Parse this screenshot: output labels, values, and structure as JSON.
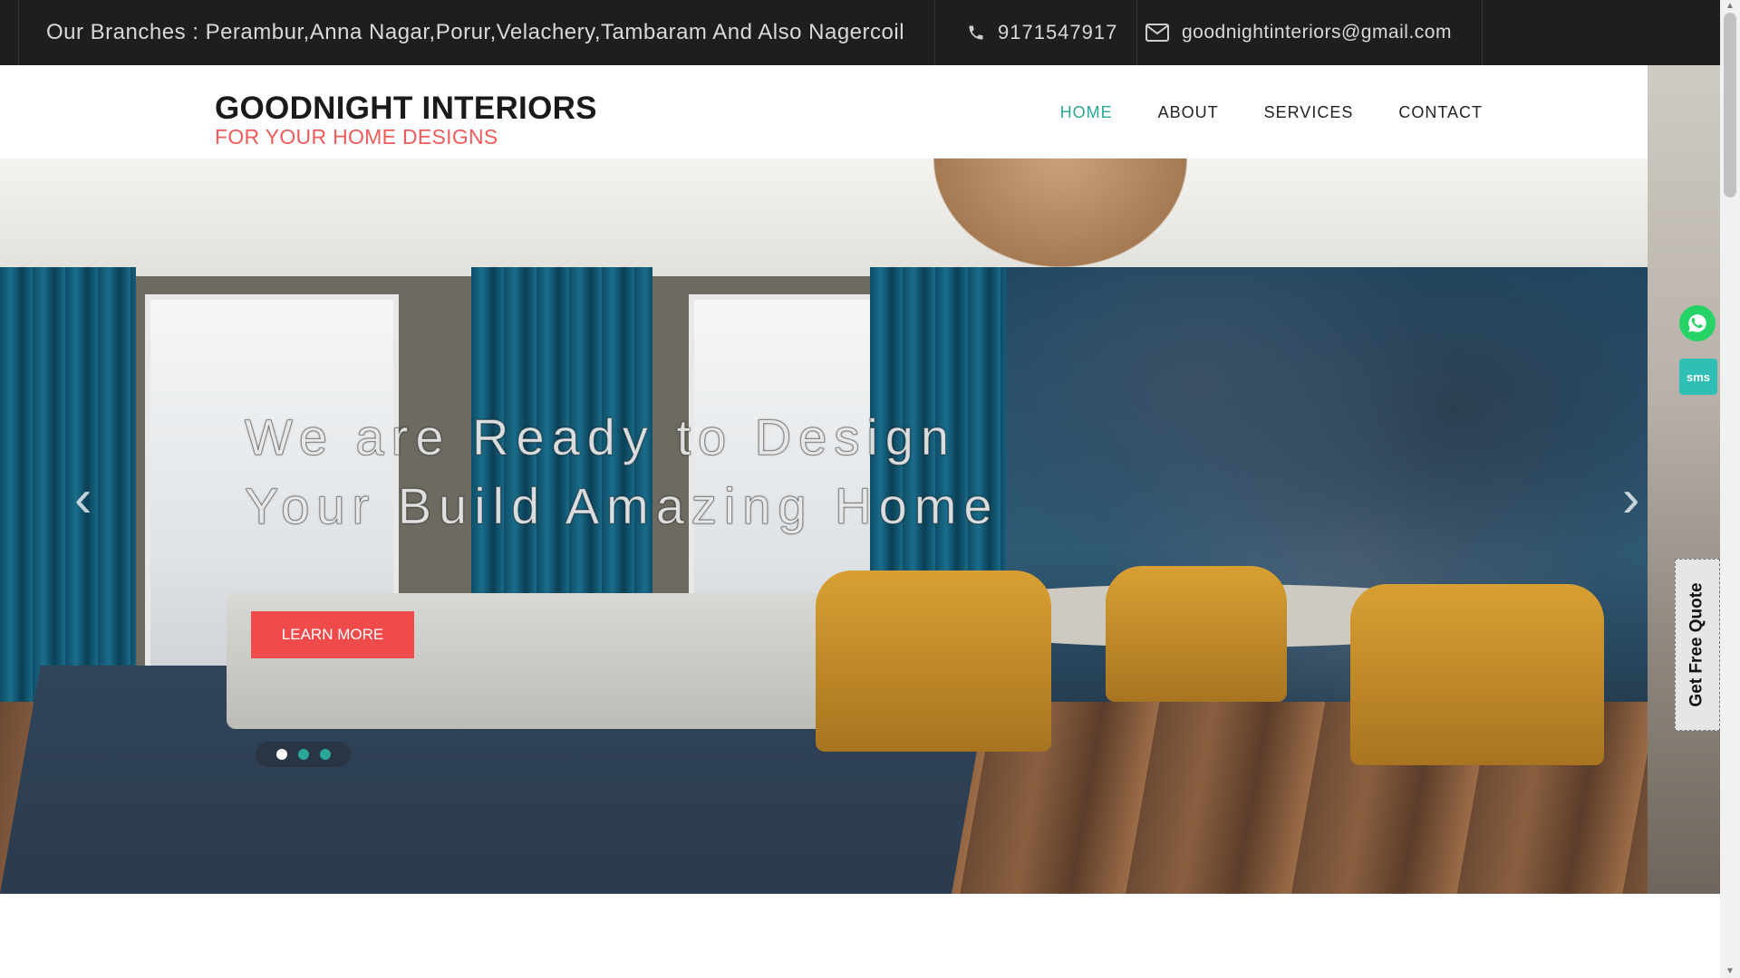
{
  "topbar": {
    "branches": "Our Branches : Perambur,Anna Nagar,Porur,Velachery,Tambaram And Also Nagercoil",
    "phone": "9171547917",
    "email": "goodnightinteriors@gmail.com"
  },
  "header": {
    "logo_title": "GOODNIGHT INTERIORS",
    "logo_subtitle": "FOR YOUR HOME DESIGNS",
    "nav": [
      "HOME",
      "ABOUT",
      "SERVICES",
      "CONTACT"
    ],
    "active_nav": "HOME"
  },
  "hero": {
    "headline_line1": "We are Ready to Design",
    "headline_line2": "Your Build Amazing Home",
    "cta_label": "LEARN MORE",
    "slides_count": 3,
    "active_slide": 1
  },
  "sidebar": {
    "whatsapp_icon": "whatsapp-icon",
    "sms_label": "sms",
    "quote_label": "Get Free Quote"
  },
  "colors": {
    "accent": "#2aa797",
    "brand_red": "#ef4b4b",
    "topbar_bg": "#1e1e1e"
  }
}
